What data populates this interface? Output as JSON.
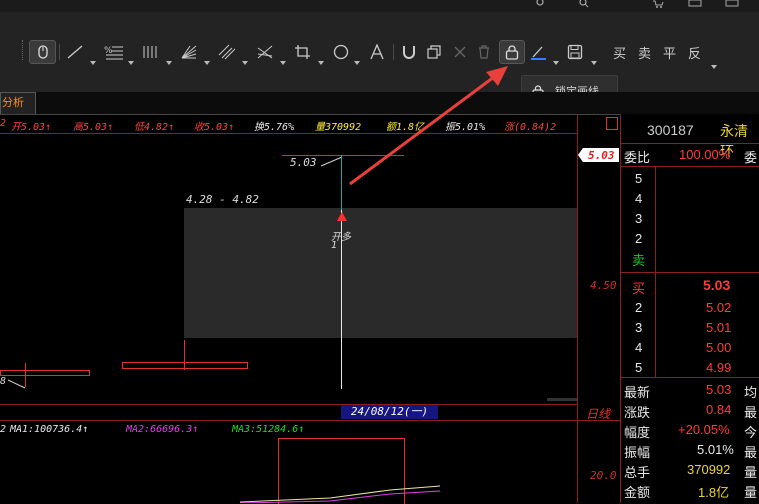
{
  "toolbar": {
    "trade_labels": [
      "买",
      "卖",
      "平",
      "反"
    ],
    "tooltip": "锁定画线"
  },
  "tab": {
    "label": "分析"
  },
  "quote_bar": {
    "open": "开5.03↑",
    "high": "高5.03↑",
    "low": "低4.82↑",
    "close": "收5.03↑",
    "turnover": "换5.76%",
    "volume": "量370992",
    "amount": "额1.8亿",
    "amplitude": "振5.01%",
    "extra": "涨(0.84)2"
  },
  "left_fragment": {
    "quote": "2",
    "ma": "2",
    "price": "8"
  },
  "chart": {
    "price_high_label": "5.03",
    "range_label": "4.28 - 4.82",
    "signal_label": "开多",
    "signal_count": "1",
    "axis_price_tag": "5.03",
    "axis_mid_label": "4.50",
    "date_label": "24/08/12(一)",
    "period_label": "日线",
    "axis_vol_label": "20.0"
  },
  "volume_bar": {
    "ma1": "MA1:100736.4↑",
    "ma2": "MA2:66696.3↑",
    "ma3": "MA3:51284.6↑"
  },
  "stock": {
    "code": "300187",
    "name": "永清环",
    "menu_glyph": "回"
  },
  "order_book": {
    "weibi_label": "委比",
    "weibi_value": "100.00%",
    "weicha_label": "委",
    "sell_levels": [
      "5",
      "4",
      "3",
      "2"
    ],
    "sell_label": "卖",
    "buy_label": "买",
    "buy_first": "5.03",
    "buy_levels": [
      {
        "n": "2",
        "price": "5.02"
      },
      {
        "n": "3",
        "price": "5.01"
      },
      {
        "n": "4",
        "price": "5.00"
      },
      {
        "n": "5",
        "price": "4.99"
      }
    ]
  },
  "stats": [
    {
      "label": "最新",
      "value": "5.03",
      "tail": "均"
    },
    {
      "label": "涨跌",
      "value": "0.84",
      "tail": "最"
    },
    {
      "label": "幅度",
      "value": "+20.05%",
      "tail": "今"
    },
    {
      "label": "振幅",
      "value": "5.01%",
      "tail": "最"
    },
    {
      "label": "总手",
      "value": "370992",
      "tail": "量"
    },
    {
      "label": "金额",
      "value": "1.8亿",
      "tail": "量"
    }
  ]
}
